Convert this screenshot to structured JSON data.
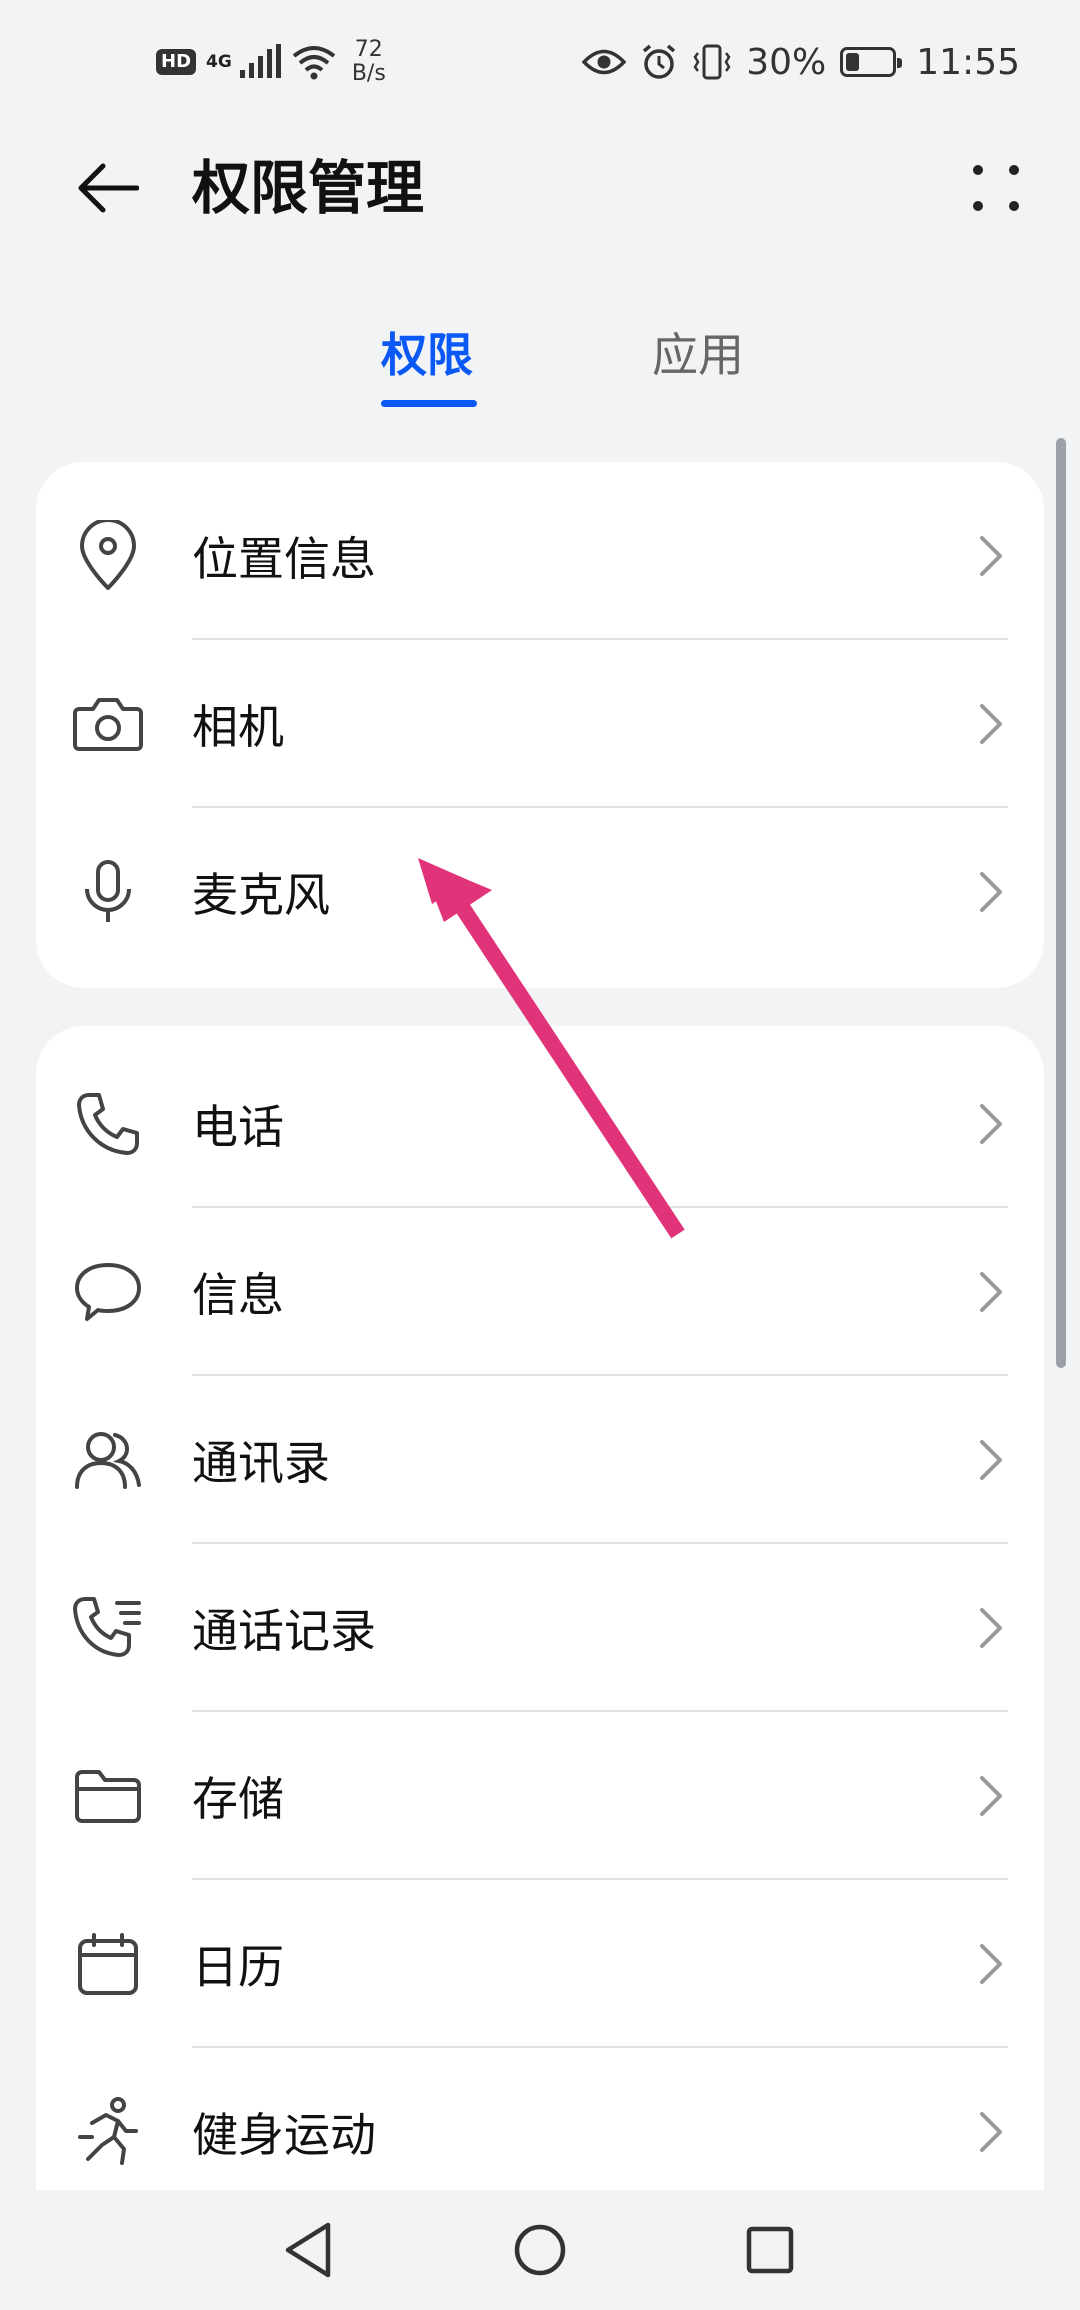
{
  "status_bar": {
    "hd": "HD",
    "net_type": "4G",
    "speed_value": "72",
    "speed_unit": "B/s",
    "battery_percent": "30%",
    "battery_level": 0.3,
    "time": "11:55"
  },
  "header": {
    "title": "权限管理"
  },
  "tabs": [
    {
      "label": "权限",
      "active": true
    },
    {
      "label": "应用",
      "active": false
    }
  ],
  "groups": [
    {
      "items": [
        {
          "label": "位置信息",
          "icon": "location-icon"
        },
        {
          "label": "相机",
          "icon": "camera-icon"
        },
        {
          "label": "麦克风",
          "icon": "microphone-icon"
        }
      ]
    },
    {
      "items": [
        {
          "label": "电话",
          "icon": "phone-icon"
        },
        {
          "label": "信息",
          "icon": "message-icon"
        },
        {
          "label": "通讯录",
          "icon": "contacts-icon"
        },
        {
          "label": "通话记录",
          "icon": "call-log-icon"
        },
        {
          "label": "存储",
          "icon": "folder-icon"
        },
        {
          "label": "日历",
          "icon": "calendar-icon"
        },
        {
          "label": "健身运动",
          "icon": "running-icon"
        }
      ]
    }
  ],
  "colors": {
    "accent": "#0a59f7",
    "annotation": "#e0337a",
    "background": "#f1f3f5",
    "card": "#ffffff"
  }
}
